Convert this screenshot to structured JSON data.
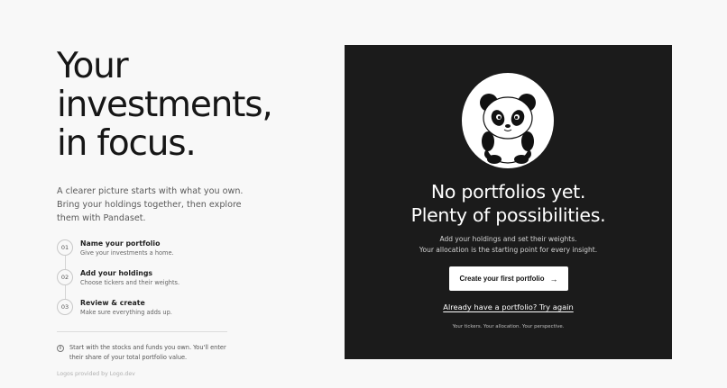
{
  "hero": {
    "title_lines": [
      "Your",
      "investments,",
      "in focus."
    ],
    "lede": "A clearer picture starts with what you own. Bring your holdings together, then explore them with Pandaset."
  },
  "steps": [
    {
      "num": "01",
      "title": "Name your portfolio",
      "sub": "Give your investments a home."
    },
    {
      "num": "02",
      "title": "Add your holdings",
      "sub": "Choose tickers and their weights."
    },
    {
      "num": "03",
      "title": "Review & create",
      "sub": "Make sure everything adds up."
    }
  ],
  "note": {
    "icon": "info-icon",
    "text": "Start with the stocks and funds you own. You'll enter their share of your total portfolio value."
  },
  "credit": "Logos provided by Logo.dev",
  "panel": {
    "illustration": "panda-icon",
    "title_lines": [
      "No portfolios yet.",
      "Plenty of possibilities."
    ],
    "sub_lines": [
      "Add your holdings and set their weights.",
      "Your allocation is the starting point for every insight."
    ],
    "cta_label": "Create your first portfolio",
    "cta_icon": "arrow-right-icon",
    "retry_label": "Already have a portfolio? Try again",
    "tagline": "Your tickers. Your allocation. Your perspective."
  },
  "colors": {
    "background": "#f8f8f8",
    "panel": "#1b1b1b",
    "cta_bg": "#ffffff"
  }
}
